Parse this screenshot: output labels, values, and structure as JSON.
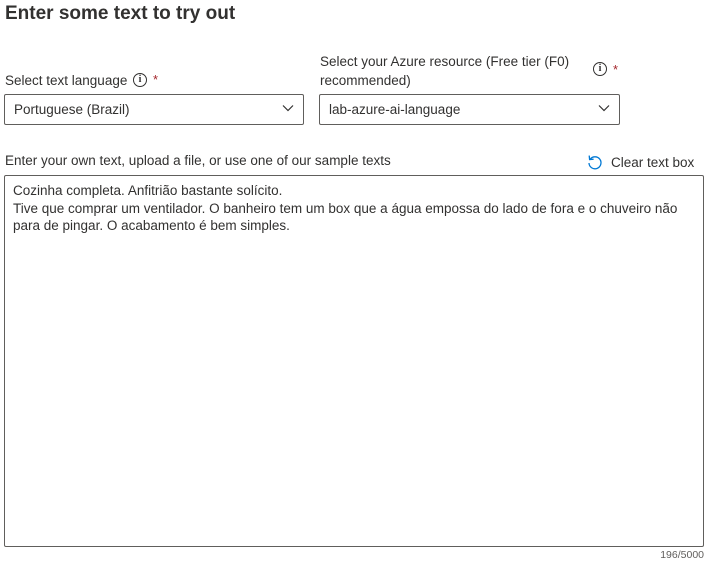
{
  "section": {
    "title": "Enter some text to try out"
  },
  "language_field": {
    "label": "Select text language",
    "required_marker": "*",
    "selected_value": "Portuguese (Brazil)"
  },
  "resource_field": {
    "label": "Select your Azure resource (Free tier (F0) recommended)",
    "required_marker": "*",
    "selected_value": "lab-azure-ai-language"
  },
  "text_input": {
    "instructions": "Enter your own text, upload a file, or use one of our sample texts",
    "clear_label": "Clear text box",
    "value": "Cozinha completa. Anfitrião bastante solícito.\nTive que comprar um ventilador. O banheiro tem um box que a água empossa do lado de fora e o chuveiro não para de pingar. O acabamento é bem simples.",
    "char_count": "196/5000"
  },
  "icons": {
    "info": "info-icon",
    "chevron": "chevron-down-icon",
    "refresh": "refresh-icon"
  },
  "colors": {
    "required": "#a4262c",
    "accent": "#0078d4",
    "border": "#605e5c",
    "text": "#323130"
  }
}
